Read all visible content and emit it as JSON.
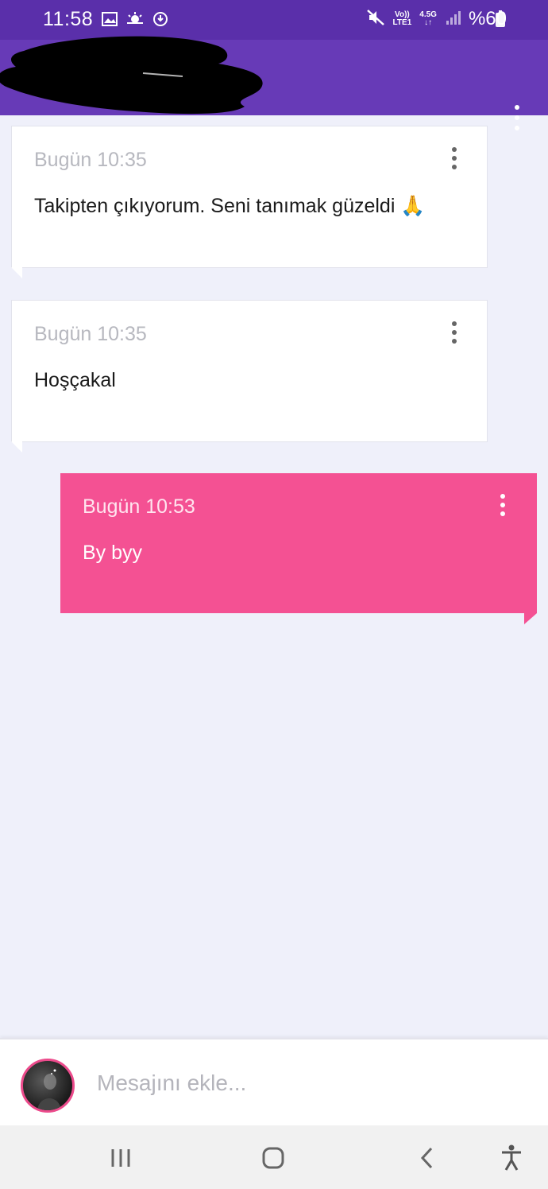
{
  "status_bar": {
    "time": "11:58",
    "volte": "Vo))",
    "lte": "LTE1",
    "network": "4.5G",
    "battery": "%60",
    "icons": [
      "gallery-icon",
      "weather-icon",
      "bulb-icon",
      "mute-icon",
      "signal-icon",
      "battery-icon"
    ]
  },
  "app_bar": {
    "menu_icon": "more-vert-icon"
  },
  "messages": [
    {
      "timestamp": "Bugün 10:35",
      "text": "Takipten çıkıyorum. Seni tanımak güzeldi 🙏",
      "own": false
    },
    {
      "timestamp": "Bugün 10:35",
      "text": "Hoşçakal",
      "own": false
    },
    {
      "timestamp": "Bugün 10:53",
      "text": "By byy",
      "own": true
    }
  ],
  "composer": {
    "placeholder": "Mesajını ekle..."
  },
  "nav_bar": {
    "icons": [
      "recents-icon",
      "home-icon",
      "back-icon",
      "accessibility-icon"
    ]
  },
  "colors": {
    "status_bar": "#5a2faa",
    "app_bar": "#673ab7",
    "background": "#eff0fa",
    "own_message": "#f45193"
  }
}
